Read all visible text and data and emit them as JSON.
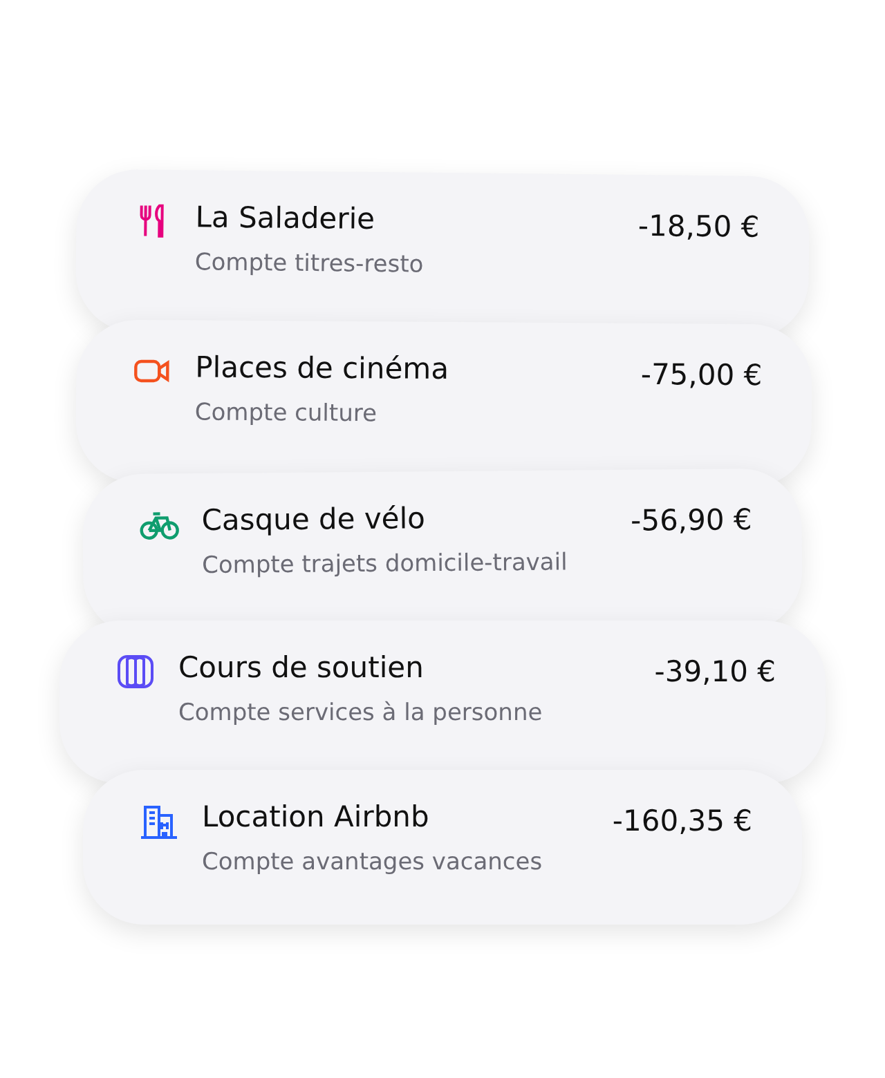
{
  "transactions": [
    {
      "kind": "meal",
      "color": "#e6007e",
      "title": "La Saladerie",
      "account": "Compte titres-resto",
      "amount": "-18,50 €"
    },
    {
      "kind": "camera",
      "color": "#f4511e",
      "title": "Places de cinéma",
      "account": "Compte culture",
      "amount": "-75,00 €"
    },
    {
      "kind": "bike",
      "color": "#0f9d6e",
      "title": "Casque de vélo",
      "account": "Compte trajets domicile-travail",
      "amount": "-56,90 €"
    },
    {
      "kind": "book",
      "color": "#5b4cf5",
      "title": "Cours de soutien",
      "account": "Compte services à la personne",
      "amount": "-39,10 €"
    },
    {
      "kind": "building",
      "color": "#2962ff",
      "title": "Location Airbnb",
      "account": "Compte avantages vacances",
      "amount": "-160,35 €"
    }
  ]
}
